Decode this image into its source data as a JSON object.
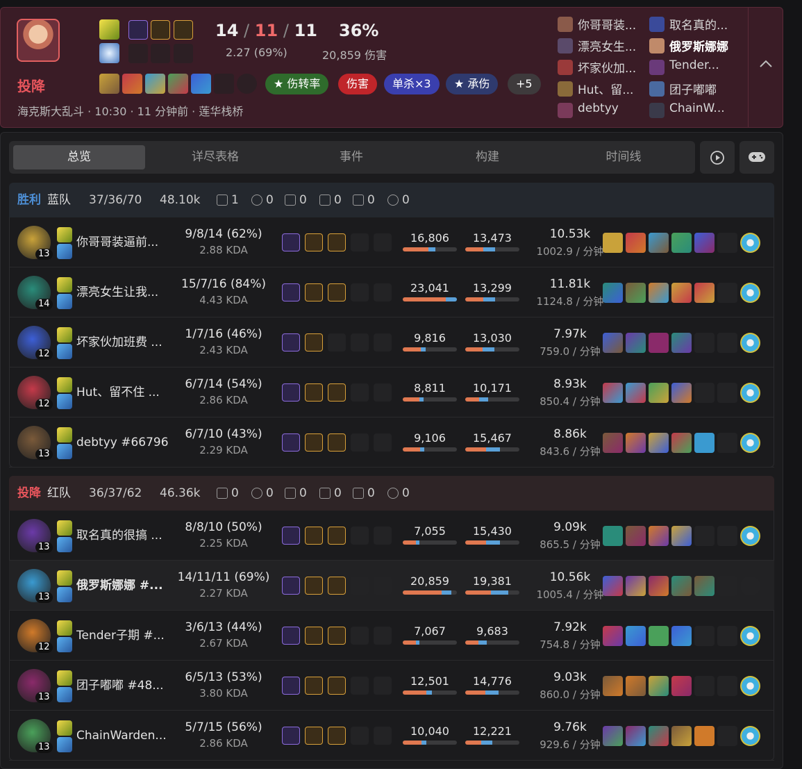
{
  "header": {
    "result": "投降",
    "kda_k": "14",
    "kda_d": "11",
    "kda_a": "11",
    "kda_sep": "/",
    "ratio": "2.27 (69%)",
    "kp": "36%",
    "damage": "20,859 伤害",
    "meta": "海克斯大乱斗 · 10:30 · 11 分钟前 · 莲华栈桥",
    "tags": [
      {
        "label": "★ 伤转率",
        "color": "#2f6b2c"
      },
      {
        "label": "伤害",
        "color": "#c0252a"
      },
      {
        "label": "单杀×3",
        "color": "#3a3fae"
      },
      {
        "label": "★ 承伤",
        "color": "#2f3a6e"
      },
      {
        "label": "+5",
        "color": "#3e3a3c"
      }
    ],
    "players_left": [
      "你哥哥装...",
      "漂亮女生...",
      "坏家伙加...",
      "Hut、留...",
      "debtyy"
    ],
    "players_right": [
      "取名真的...",
      "俄罗斯娜娜",
      "Tender...",
      "团子嘟嘟",
      "ChainW..."
    ]
  },
  "tabs": [
    "总览",
    "详尽表格",
    "事件",
    "构建",
    "时间线"
  ],
  "buttons": {
    "replay": "replay-icon",
    "game": "gamepad-icon"
  },
  "teams": [
    {
      "result": "胜利",
      "side": "蓝队",
      "kda": "37/36/70",
      "gold": "48.10k",
      "obj": [
        "1",
        "0",
        "0",
        "0",
        "0",
        "0"
      ],
      "result_color": "#4d8fd6",
      "bg": "#24282e",
      "players": [
        {
          "name": "你哥哥装逼前...",
          "level": "13",
          "kda": "9/8/14 (62%)",
          "ratio": "2.88 KDA",
          "dmg": "16,806",
          "taken": "13,473",
          "gold": "10.53k",
          "gpm": "1002.9 / 分钟",
          "dmg_frac": 0.6,
          "taken_frac": 0.55,
          "runes": 3
        },
        {
          "name": "漂亮女生让我...",
          "level": "14",
          "kda": "15/7/16 (84%)",
          "ratio": "4.43 KDA",
          "dmg": "23,041",
          "taken": "13,299",
          "gold": "11.81k",
          "gpm": "1124.8 / 分钟",
          "dmg_frac": 1.0,
          "taken_frac": 0.55,
          "runes": 3
        },
        {
          "name": "坏家伙加班费 ...",
          "level": "12",
          "kda": "1/7/16 (46%)",
          "ratio": "2.43 KDA",
          "dmg": "9,816",
          "taken": "13,030",
          "gold": "7.97k",
          "gpm": "759.0 / 分钟",
          "dmg_frac": 0.42,
          "taken_frac": 0.54,
          "runes": 2
        },
        {
          "name": "Hut、留不住 ...",
          "level": "12",
          "kda": "6/7/14 (54%)",
          "ratio": "2.86 KDA",
          "dmg": "8,811",
          "taken": "10,171",
          "gold": "8.93k",
          "gpm": "850.4 / 分钟",
          "dmg_frac": 0.38,
          "taken_frac": 0.42,
          "runes": 3
        },
        {
          "name": "debtyy #66796",
          "level": "13",
          "kda": "6/7/10 (43%)",
          "ratio": "2.29 KDA",
          "dmg": "9,106",
          "taken": "15,467",
          "gold": "8.86k",
          "gpm": "843.6 / 分钟",
          "dmg_frac": 0.4,
          "taken_frac": 0.64,
          "runes": 3
        }
      ]
    },
    {
      "result": "投降",
      "side": "红队",
      "kda": "36/37/62",
      "gold": "46.36k",
      "obj": [
        "0",
        "0",
        "0",
        "0",
        "0",
        "0"
      ],
      "result_color": "#e8555c",
      "bg": "#2e2426",
      "players": [
        {
          "name": "取名真的很搞 ...",
          "level": "13",
          "kda": "8/8/10 (50%)",
          "ratio": "2.25 KDA",
          "dmg": "7,055",
          "taken": "15,430",
          "gold": "9.09k",
          "gpm": "865.5 / 分钟",
          "dmg_frac": 0.31,
          "taken_frac": 0.64,
          "runes": 3
        },
        {
          "name": "俄罗斯娜娜 #...",
          "level": "13",
          "kda": "14/11/11 (69%)",
          "ratio": "2.27 KDA",
          "dmg": "20,859",
          "taken": "19,381",
          "gold": "10.56k",
          "gpm": "1005.4 / 分钟",
          "dmg_frac": 0.9,
          "taken_frac": 0.8,
          "runes": 3
        },
        {
          "name": "Tender子期 #...",
          "level": "12",
          "kda": "3/6/13 (44%)",
          "ratio": "2.67 KDA",
          "dmg": "7,067",
          "taken": "9,683",
          "gold": "7.92k",
          "gpm": "754.8 / 分钟",
          "dmg_frac": 0.31,
          "taken_frac": 0.4,
          "runes": 3
        },
        {
          "name": "团子嘟嘟 #48...",
          "level": "13",
          "kda": "6/5/13 (53%)",
          "ratio": "3.80 KDA",
          "dmg": "12,501",
          "taken": "14,776",
          "gold": "9.03k",
          "gpm": "860.0 / 分钟",
          "dmg_frac": 0.54,
          "taken_frac": 0.61,
          "runes": 3
        },
        {
          "name": "ChainWarden...",
          "level": "13",
          "kda": "5/7/15 (56%)",
          "ratio": "2.86 KDA",
          "dmg": "10,040",
          "taken": "12,221",
          "gold": "9.76k",
          "gpm": "929.6 / 分钟",
          "dmg_frac": 0.44,
          "taken_frac": 0.5,
          "runes": 3
        }
      ]
    }
  ]
}
